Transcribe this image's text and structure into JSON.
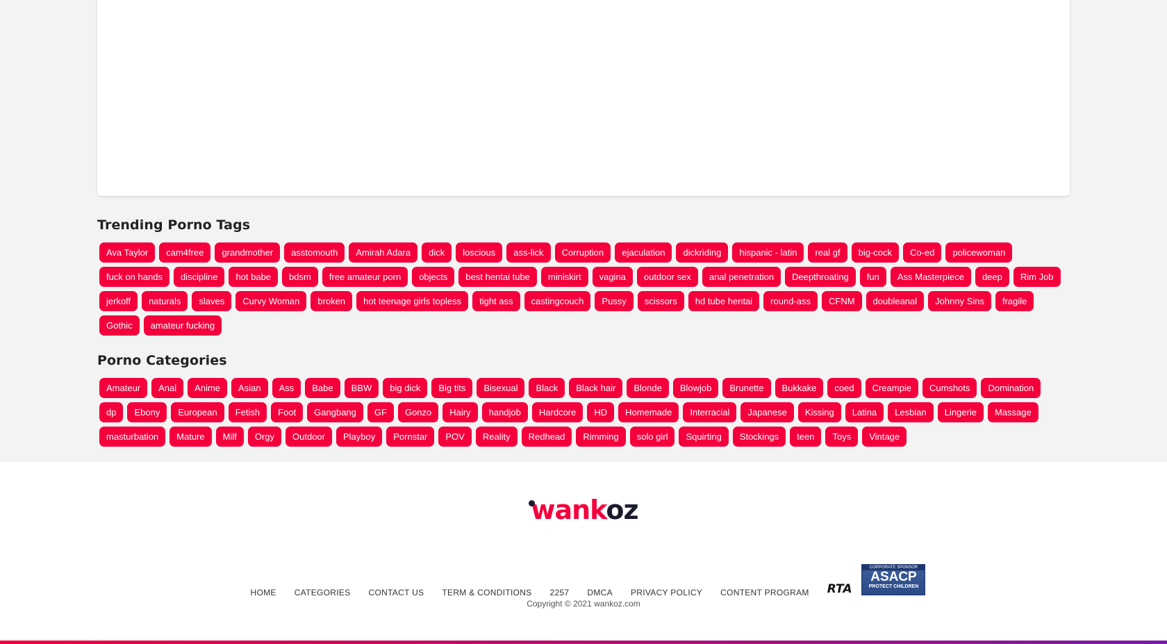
{
  "trending": {
    "title": "Trending Porno Tags",
    "tags": [
      "Ava Taylor",
      "cam4free",
      "grandmother",
      "asstomouth",
      "Amirah Adara",
      "dick",
      "loscious",
      "ass-lick",
      "Corruption",
      "ejaculation",
      "dickriding",
      "hispanic - latin",
      "real gf",
      "big-cock",
      "Co-ed",
      "policewoman",
      "fuck on hands",
      "discipline",
      "hot babe",
      "bdsm",
      "free amateur porn",
      "objects",
      "best hentai tube",
      "miniskirt",
      "vagina",
      "outdoor sex",
      "anal penetration",
      "Deepthroating",
      "fun",
      "Ass Masterpiece",
      "deep",
      "Rim Job",
      "jerkoff",
      "naturals",
      "slaves",
      "Curvy Woman",
      "broken",
      "hot teenage girls topless",
      "tight ass",
      "castingcouch",
      "Pussy",
      "scissors",
      "hd tube hentai",
      "round-ass",
      "CFNM",
      "doubleanal",
      "Johnny Sins",
      "fragile",
      "Gothic",
      "amateur fucking"
    ]
  },
  "categories": {
    "title": "Porno Categories",
    "tags": [
      "Amateur",
      "Anal",
      "Anime",
      "Asian",
      "Ass",
      "Babe",
      "BBW",
      "big dick",
      "Big tits",
      "Bisexual",
      "Black",
      "Black hair",
      "Blonde",
      "Blowjob",
      "Brunette",
      "Bukkake",
      "coed",
      "Creampie",
      "Cumshots",
      "Domination",
      "dp",
      "Ebony",
      "European",
      "Fetish",
      "Foot",
      "Gangbang",
      "GF",
      "Gonzo",
      "Hairy",
      "handjob",
      "Hardcore",
      "HD",
      "Homemade",
      "Interracial",
      "Japanese",
      "Kissing",
      "Latina",
      "Lesbian",
      "Lingerie",
      "Massage",
      "masturbation",
      "Mature",
      "Milf",
      "Orgy",
      "Outdoor",
      "Playboy",
      "Pornstar",
      "POV",
      "Reality",
      "Redhead",
      "Rimming",
      "solo girl",
      "Squirting",
      "Stockings",
      "teen",
      "Toys",
      "Vintage"
    ]
  },
  "logo": {
    "part1": "wank",
    "part2": "oz"
  },
  "footer": {
    "nav": [
      "HOME",
      "CATEGORIES",
      "CONTACT US",
      "TERM & CONDITIONS",
      "2257",
      "DMCA",
      "PRIVACY POLICY",
      "CONTENT PROGRAM"
    ],
    "rta_label": "RTA",
    "asacp": {
      "top": "CORPORATE SPONSOR",
      "main": "ASACP",
      "bottom": "PROTECT CHILDREN"
    },
    "copyright": "Copyright © 2021 wankoz.com"
  },
  "colors": {
    "accent": "#f4003d",
    "logo_dark": "#1b1b2e",
    "background": "#f3f3f3"
  }
}
